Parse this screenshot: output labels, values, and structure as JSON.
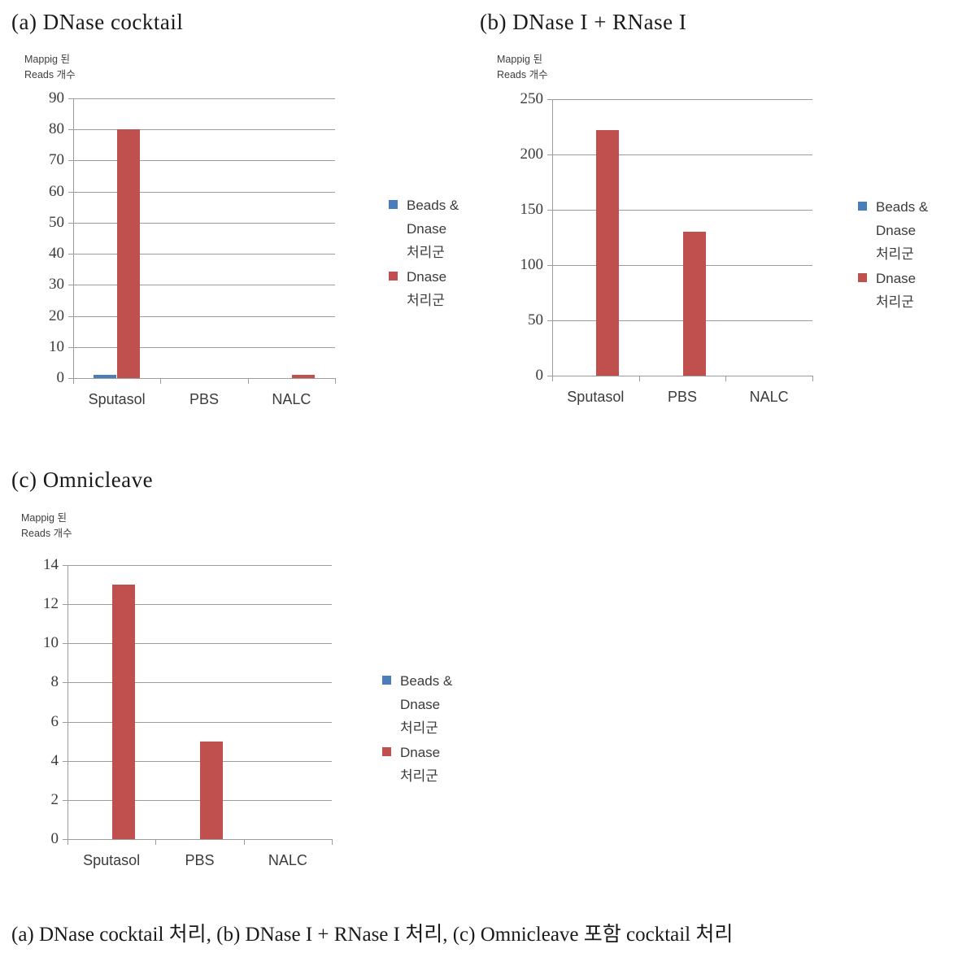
{
  "figure": {
    "caption": "(a) DNase cocktail 처리, (b) DNase I + RNase I 처리, (c) Omnicleave 포함 cocktail 처리"
  },
  "colors": {
    "series_beads_dnase": "#4A7EBB",
    "series_dnase": "#C0504D",
    "grid": "#9C9C9C",
    "tick_text": "#3B3B3B",
    "title_text": "#1A1A1A"
  },
  "panels": [
    {
      "id": "a",
      "title": "(a) DNase cocktail",
      "axis_caption_line1": "Mappig 된",
      "axis_caption_line2": "Reads 개수",
      "legend": {
        "entries": [
          {
            "swatch": "#4A7EBB",
            "line1": "Beads &",
            "line2": "Dnase",
            "line3": "처리군"
          },
          {
            "swatch": "#C0504D",
            "line1": "Dnase",
            "line2": "처리군",
            "line3": ""
          }
        ]
      }
    },
    {
      "id": "b",
      "title": "(b) DNase I + RNase I",
      "axis_caption_line1": "Mappig 된",
      "axis_caption_line2": "Reads 개수",
      "legend": {
        "entries": [
          {
            "swatch": "#4A7EBB",
            "line1": "Beads &",
            "line2": "Dnase",
            "line3": "처리군"
          },
          {
            "swatch": "#C0504D",
            "line1": "Dnase",
            "line2": "처리군",
            "line3": ""
          }
        ]
      }
    },
    {
      "id": "c",
      "title": "(c) Omnicleave",
      "axis_caption_line1": "Mappig 된",
      "axis_caption_line2": "Reads 개수",
      "legend": {
        "entries": [
          {
            "swatch": "#4A7EBB",
            "line1": "Beads &",
            "line2": "Dnase",
            "line3": "처리군"
          },
          {
            "swatch": "#C0504D",
            "line1": "Dnase",
            "line2": "처리군",
            "line3": ""
          }
        ]
      }
    }
  ],
  "chart_data": [
    {
      "panel": "a",
      "type": "bar",
      "title": "(a) DNase cocktail",
      "xlabel": "",
      "ylabel": "Mappig 된 Reads 개수",
      "categories": [
        "Sputasol",
        "PBS",
        "NALC"
      ],
      "series": [
        {
          "name": "Beads & Dnase 처리군",
          "color": "#4A7EBB",
          "values": [
            1,
            0,
            0
          ]
        },
        {
          "name": "Dnase 처리군",
          "color": "#C0504D",
          "values": [
            80,
            0,
            1
          ]
        }
      ],
      "ylim": [
        0,
        90
      ],
      "yticks": [
        0,
        10,
        20,
        30,
        40,
        50,
        60,
        70,
        80,
        90
      ],
      "grid": true,
      "legend_position": "right"
    },
    {
      "panel": "b",
      "type": "bar",
      "title": "(b) DNase I + RNase I",
      "xlabel": "",
      "ylabel": "Mappig 된 Reads 개수",
      "categories": [
        "Sputasol",
        "PBS",
        "NALC"
      ],
      "series": [
        {
          "name": "Beads & Dnase 처리군",
          "color": "#4A7EBB",
          "values": [
            0,
            0,
            0
          ]
        },
        {
          "name": "Dnase 처리군",
          "color": "#C0504D",
          "values": [
            222,
            130,
            0
          ]
        }
      ],
      "ylim": [
        0,
        250
      ],
      "yticks": [
        0,
        50,
        100,
        150,
        200,
        250
      ],
      "grid": true,
      "legend_position": "right"
    },
    {
      "panel": "c",
      "type": "bar",
      "title": "(c) Omnicleave",
      "xlabel": "",
      "ylabel": "Mappig 된 Reads 개수",
      "categories": [
        "Sputasol",
        "PBS",
        "NALC"
      ],
      "series": [
        {
          "name": "Beads & Dnase 처리군",
          "color": "#4A7EBB",
          "values": [
            0,
            0,
            0
          ]
        },
        {
          "name": "Dnase 처리군",
          "color": "#C0504D",
          "values": [
            13,
            5,
            0
          ]
        }
      ],
      "ylim": [
        0,
        14
      ],
      "yticks": [
        0,
        2,
        4,
        6,
        8,
        10,
        12,
        14
      ],
      "grid": true,
      "legend_position": "right"
    }
  ]
}
